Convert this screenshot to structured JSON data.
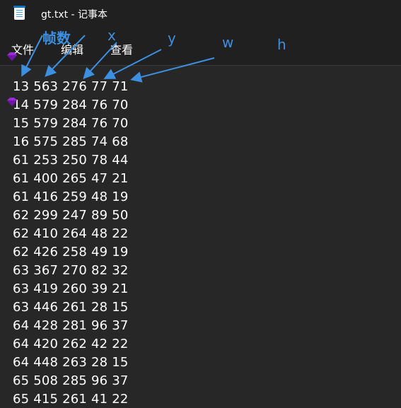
{
  "window": {
    "title": "gt.txt - 记事本"
  },
  "menu": {
    "items": [
      "文件",
      "编辑",
      "查看"
    ]
  },
  "annotations": {
    "labels": [
      "帧数",
      "x",
      "y",
      "w",
      "h"
    ],
    "color": "#3d8fe0"
  },
  "document": {
    "lines": [
      "13 563 276 77 71",
      "14 579 284 76 70",
      "15 579 284 76 70",
      "16 575 285 74 68",
      "61 253 250 78 44",
      "61 400 265 47 21",
      "61 416 259 48 19",
      "62 299 247 89 50",
      "62 410 264 48 22",
      "62 426 258 49 19",
      "63 367 270 82 32",
      "63 419 260 39 21",
      "63 446 261 28 15",
      "64 428 281 96 37",
      "64 420 262 42 22",
      "64 448 263 28 15",
      "65 508 285 96 37",
      "65 415 261 41 22"
    ]
  },
  "icons": {
    "app": "notepad-icon",
    "marker": "purple-gem-icon"
  }
}
